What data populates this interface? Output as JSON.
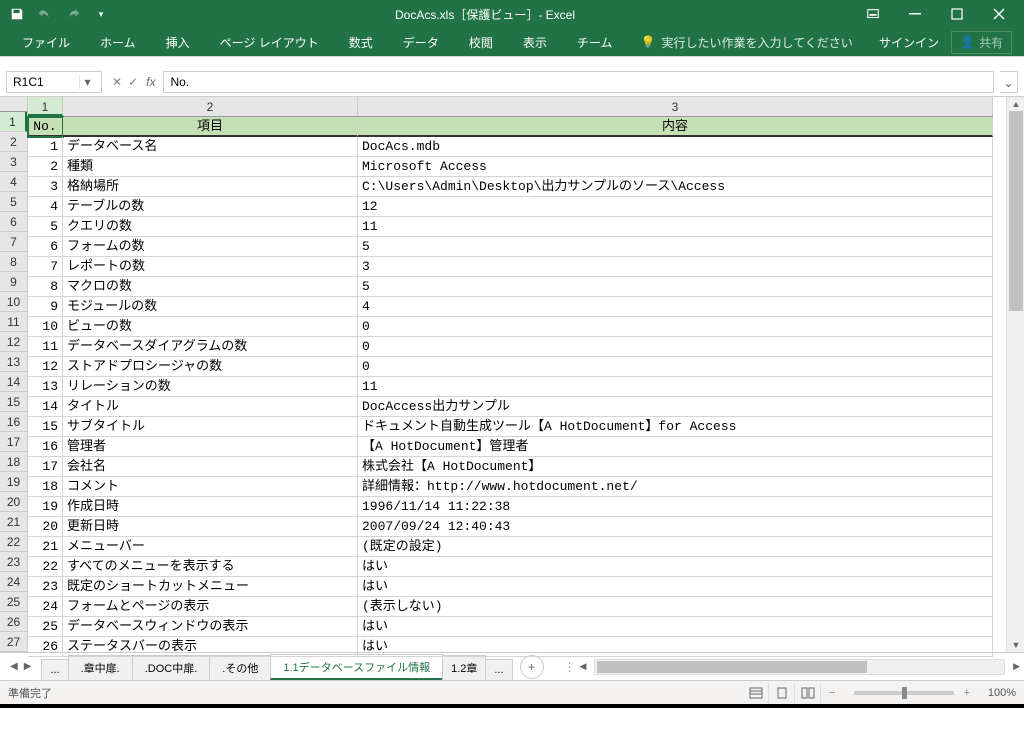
{
  "window": {
    "title": "DocAcs.xls［保護ビュー］- Excel",
    "signin": "サインイン",
    "share": "共有"
  },
  "ribbon": {
    "file": "ファイル",
    "home": "ホーム",
    "insert": "挿入",
    "pagelayout": "ページ レイアウト",
    "formulas": "数式",
    "data": "データ",
    "review": "校閲",
    "view": "表示",
    "team": "チーム",
    "tellme": "実行したい作業を入力してください"
  },
  "formula": {
    "namebox": "R1C1",
    "fx": "fx",
    "content": "No."
  },
  "col_headers": [
    "1",
    "2",
    "3"
  ],
  "row_headers": [
    "1",
    "2",
    "3",
    "4",
    "5",
    "6",
    "7",
    "8",
    "9",
    "10",
    "11",
    "12",
    "13",
    "14",
    "15",
    "16",
    "17",
    "18",
    "19",
    "20",
    "21",
    "22",
    "23",
    "24",
    "25",
    "26",
    "27"
  ],
  "header_row": {
    "c1": "No.",
    "c2": "項目",
    "c3": "内容"
  },
  "rows": [
    {
      "no": "1",
      "item": "データベース名",
      "val": "DocAcs.mdb"
    },
    {
      "no": "2",
      "item": "種類",
      "val": "Microsoft Access"
    },
    {
      "no": "3",
      "item": "格納場所",
      "val": "C:\\Users\\Admin\\Desktop\\出力サンプルのソース\\Access"
    },
    {
      "no": "4",
      "item": "テーブルの数",
      "val": "12"
    },
    {
      "no": "5",
      "item": "クエリの数",
      "val": "11"
    },
    {
      "no": "6",
      "item": "フォームの数",
      "val": "5"
    },
    {
      "no": "7",
      "item": "レポートの数",
      "val": "3"
    },
    {
      "no": "8",
      "item": "マクロの数",
      "val": "5"
    },
    {
      "no": "9",
      "item": "モジュールの数",
      "val": "4"
    },
    {
      "no": "10",
      "item": "ビューの数",
      "val": "0"
    },
    {
      "no": "11",
      "item": "データベースダイアグラムの数",
      "val": "0"
    },
    {
      "no": "12",
      "item": "ストアドプロシージャの数",
      "val": "0"
    },
    {
      "no": "13",
      "item": "リレーションの数",
      "val": "11"
    },
    {
      "no": "14",
      "item": "タイトル",
      "val": "DocAccess出力サンプル"
    },
    {
      "no": "15",
      "item": "サブタイトル",
      "val": "ドキュメント自動生成ツール【A HotDocument】for Access"
    },
    {
      "no": "16",
      "item": "管理者",
      "val": "【A HotDocument】管理者"
    },
    {
      "no": "17",
      "item": "会社名",
      "val": "株式会社【A HotDocument】"
    },
    {
      "no": "18",
      "item": "コメント",
      "val": "詳細情報：http://www.hotdocument.net/"
    },
    {
      "no": "19",
      "item": "作成日時",
      "val": "1996/11/14 11:22:38"
    },
    {
      "no": "20",
      "item": "更新日時",
      "val": "2007/09/24 12:40:43"
    },
    {
      "no": "21",
      "item": "メニューバー",
      "val": "(既定の設定)"
    },
    {
      "no": "22",
      "item": "すべてのメニューを表示する",
      "val": "はい"
    },
    {
      "no": "23",
      "item": "既定のショートカットメニュー",
      "val": "はい"
    },
    {
      "no": "24",
      "item": "フォームとページの表示",
      "val": "(表示しない)"
    },
    {
      "no": "25",
      "item": "データベースウィンドウの表示",
      "val": "はい"
    },
    {
      "no": "26",
      "item": "ステータスバーの表示",
      "val": "はい"
    }
  ],
  "tabs": {
    "t0": "...",
    "t1": ".章中扉.",
    "t2": ".DOC中扉.",
    "t3": ".その他",
    "active": "1.1データベースファイル情報",
    "t5": "1.2章",
    "t6": "..."
  },
  "status": {
    "ready": "準備完了",
    "zoom": "100%",
    "minus": "−",
    "plus": "+"
  }
}
